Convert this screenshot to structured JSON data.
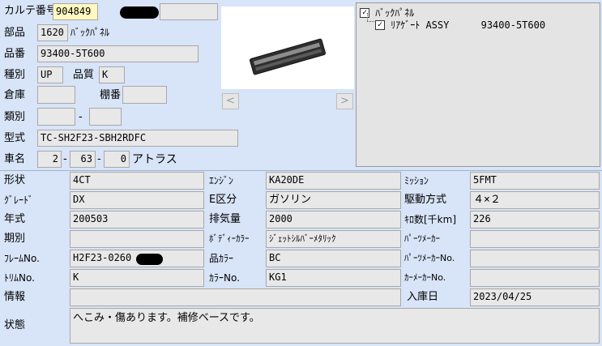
{
  "header": {
    "karte_label": "カルテ番号",
    "karte_no": "904849",
    "part_label": "部品",
    "part_code": "1620",
    "part_name": "ﾊﾞｯｸﾊﾟﾈﾙ",
    "partno_label": "品番",
    "part_number": "93400-5T600",
    "type_label": "種別",
    "type_value": "UP",
    "quality_label": "品質",
    "quality_value": "K",
    "warehouse_label": "倉庫",
    "shelf_label": "棚番",
    "category_label": "類別",
    "category_sep": "-",
    "model_label": "型式",
    "model_value": "TC-SH2F23-SBH2RDFC",
    "car_label": "車名",
    "car_code1": "2",
    "car_code2": "63",
    "car_code3": "0",
    "car_name": "アトラス"
  },
  "image_nav": {
    "prev": "<",
    "next": ">"
  },
  "tree": {
    "root_label": "ﾊﾞｯｸﾊﾟﾈﾙ",
    "child_label": "ﾘｱｹﾞｰﾄ ASSY",
    "child_partno": "93400-5T600"
  },
  "details": {
    "shape_label": "形状",
    "shape_value": "4CT",
    "engine_label": "ｴﾝｼﾞﾝ",
    "engine_value": "KA20DE",
    "mission_label": "ﾐｯｼｮﾝ",
    "mission_value": "5FMT",
    "grade_label": "ｸﾞﾚｰﾄﾞ",
    "grade_value": "DX",
    "e_label": "E区分",
    "e_value": "ガソリン",
    "drive_label": "駆動方式",
    "drive_value": "４×２",
    "year_label": "年式",
    "year_value": "200503",
    "disp_label": "排気量",
    "disp_value": "2000",
    "km_label": "ｷﾛ数[千km]",
    "km_value": "226",
    "period_label": "期別",
    "period_value": "",
    "body_color_label": "ﾎﾞﾃﾞｨｰｶﾗｰ",
    "body_color_value": "ｼﾞｪｯﾄｼﾙﾊﾞｰﾒﾀﾘｯｸ",
    "parts_maker_label": "ﾊﾟｰﾂﾒｰｶｰ",
    "parts_maker_value": "",
    "frame_label": "ﾌﾚｰﾑNo.",
    "frame_value": "H2F23-0260",
    "part_color_label": "品ｶﾗｰ",
    "part_color_value": "BC",
    "parts_maker_no_label": "ﾊﾟｰﾂﾒｰｶｰNo.",
    "parts_maker_no_value": "",
    "trim_label": "ﾄﾘﾑNo.",
    "trim_value": "K",
    "color_no_label": "ｶﾗｰNo.",
    "color_no_value": "KG1",
    "car_maker_no_label": "ｶｰﾒｰｶｰNo.",
    "car_maker_no_value": "",
    "info_label": "情報",
    "info_value": "",
    "arrival_label": "入庫日",
    "arrival_value": "2023/04/25",
    "status_label": "状態",
    "status_value": "へこみ・傷あります。補修ベースです。"
  }
}
